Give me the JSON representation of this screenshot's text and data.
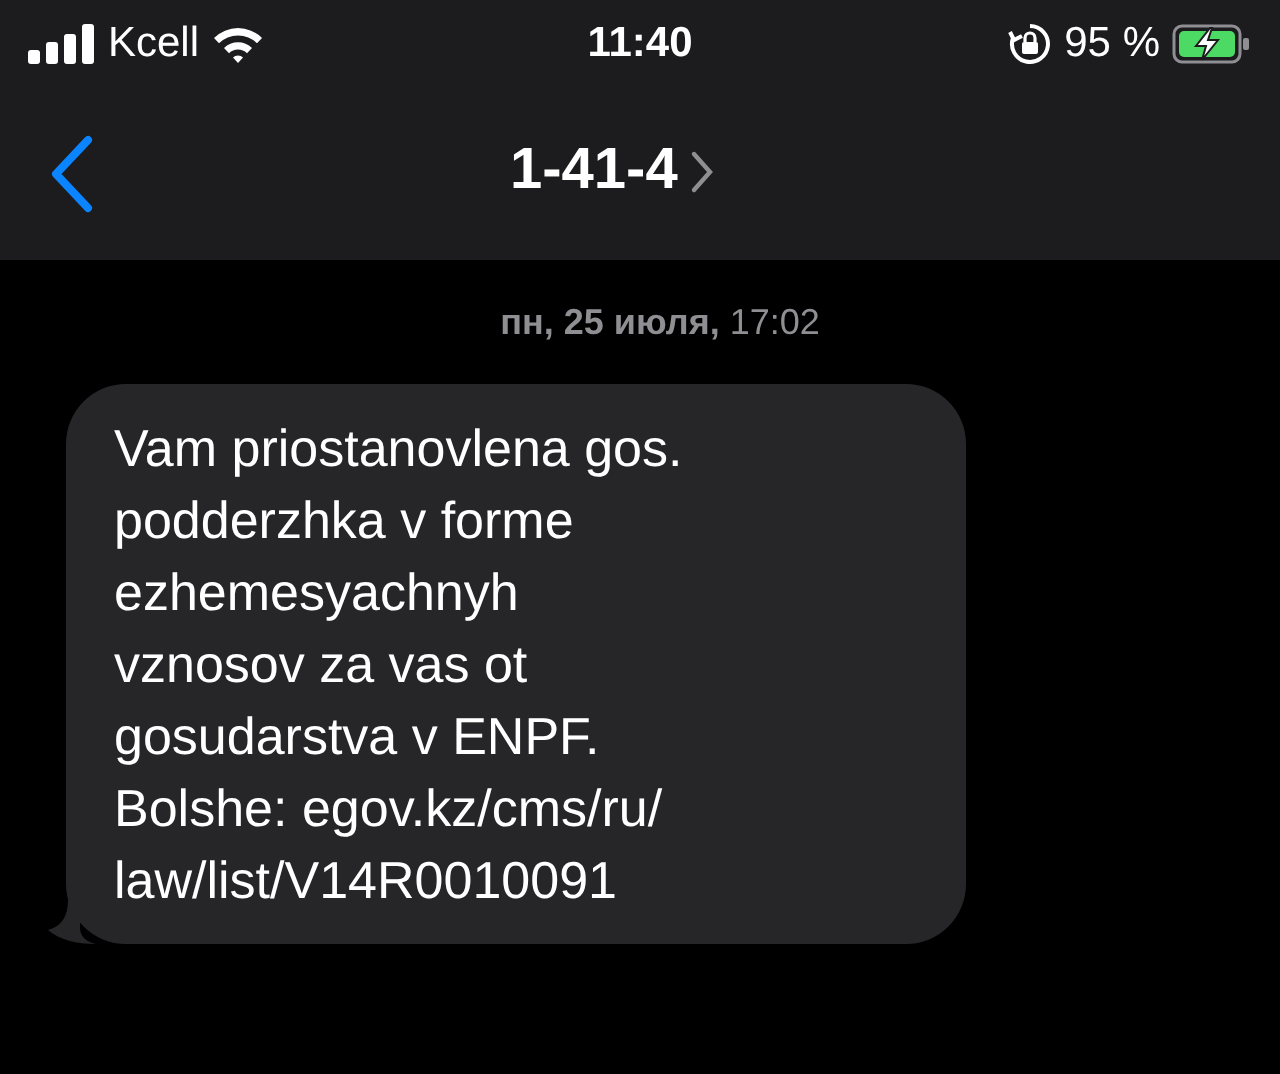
{
  "status_bar": {
    "carrier": "Kcell",
    "time": "11:40",
    "battery": "95 %"
  },
  "header": {
    "title": "1-41-4"
  },
  "conversation": {
    "timestamp": "**пн, 25 июля,** 17:02",
    "message": {
      "lines": [
        "Vam priostanovlena gos.",
        "podderzhka v forme",
        "ezhemesyachnyh",
        "vznosov za vas ot",
        "gosudarstva v ENPF.",
        "Bolshe: egov.kz/cms/ru/",
        "law/list/V14R0010091"
      ]
    }
  }
}
